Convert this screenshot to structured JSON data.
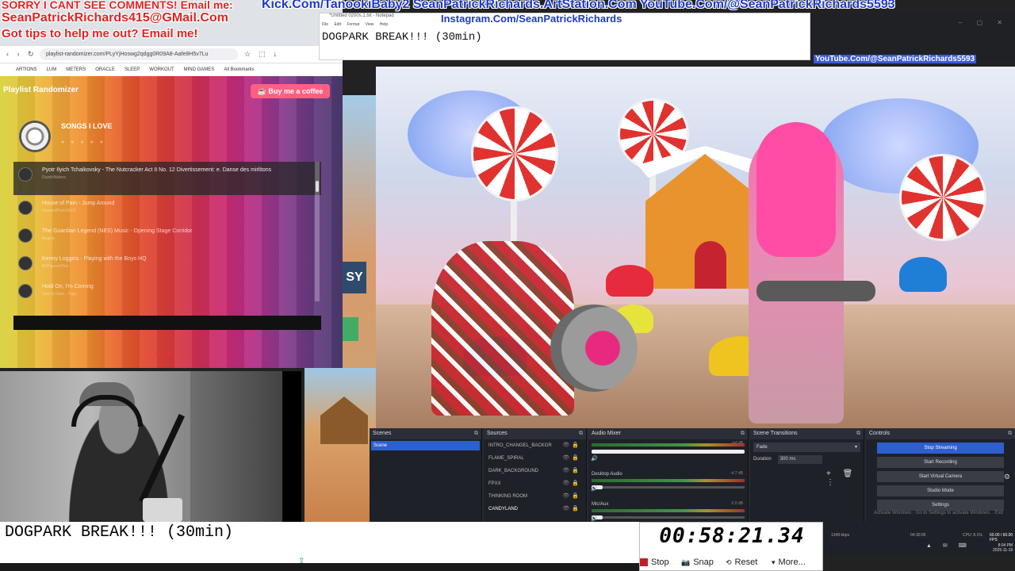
{
  "overlay": {
    "sorry": "SORRY I CANT SEE COMMENTS! Email me:",
    "email": "SeanPatrickRichards415@GMail.Com",
    "tips": "Got tips to help me out? Email me!",
    "links": "Kick.Com/TanookiBaby2 SeanPatrickRichards.ArtStation.Com YouTube.Com/@SeanPatrickRichards5593",
    "instagram": "Instagram.Com/SeanPatrickRichards",
    "youtube_small": "YouTube.Com/@SeanPatrickRichards5593"
  },
  "notepad": {
    "title": "*Untitled 0200s.1.txt - Notepad",
    "menu": "File Edit Format View Help",
    "text": "DOGPARK BREAK!!! (30min)"
  },
  "browser": {
    "url": "playlist-randomizer.com/PLyYjHoswg2qdgg0R09A8-Aafe8H5v7Lu",
    "bookmarks": [
      "ARTIONS",
      "LUM",
      "METERS",
      "ORACLE",
      "SLEEP",
      "WORKOUT",
      "MIND GAMES",
      "All Bookmarks"
    ]
  },
  "playlist": {
    "app_title": "Playlist Randomizer",
    "coffee_label": "Buy me a coffee",
    "coffee_icon": "coffee-cup-icon",
    "name": "SONGS I LOVE",
    "tracks": [
      {
        "title": "Pyotr Ilyich Tchaikovsky - The Nutcracker Act II No. 12 Divertissement: e. Danse des mirlitons",
        "artist": "DumbWalters",
        "active": true
      },
      {
        "title": "House of Pain - Jump Around",
        "artist": "HouseofPainVEVO",
        "active": false
      },
      {
        "title": "The Guardian Legend (NES) Music - Opening Stage Corridor",
        "artist": "Regina",
        "active": false
      },
      {
        "title": "Kenny Loggins - Playing with the Boys HQ",
        "artist": "MrPopcornPop",
        "active": false
      },
      {
        "title": "Hold On, I'm Coming",
        "artist": "Sam & Dave - Topic",
        "active": false
      }
    ]
  },
  "obs": {
    "scenes_title": "Scenes",
    "scenes": [
      "Scene"
    ],
    "sources_title": "Sources",
    "sources": [
      "INTRO_CHANGEL_BACKGR",
      "FLAME_SPIRAL",
      "DARK_BACKGROUND",
      "FPXX",
      "THINKING ROOM",
      "CANDYLAND"
    ],
    "mixer_title": "Audio Mixer",
    "channels": [
      {
        "name": "",
        "db": "-inf dB"
      },
      {
        "name": "Desktop Audio",
        "db": "-4.7 dB"
      },
      {
        "name": "Mic/Aux",
        "db": "0.0 dB"
      }
    ],
    "transitions_title": "Scene Transitions",
    "transition": "Fade",
    "duration_label": "Duration",
    "duration_value": "300 ms",
    "controls_title": "Controls",
    "controls": [
      "Stop Streaming",
      "Start Recording",
      "Start Virtual Camera",
      "Studio Mode",
      "Settings",
      "Exit"
    ],
    "activate": "Activate Windows",
    "activate_sub": "Go to Settings to activate Windows."
  },
  "status": {
    "kbps": "1349 kbps",
    "rec": "04:30:00",
    "cpu": "CPU: 8.1%",
    "fps": "60.00 / 60.00 FPS",
    "time": "8:04 PM",
    "date": "2025-11-19"
  },
  "bottom": {
    "title": "DOGPARK BREAK!!! (30min)"
  },
  "timer": {
    "time": "00:58:21.34",
    "stop": "Stop",
    "snap": "Snap",
    "reset": "Reset",
    "more": "More..."
  },
  "game": {
    "sign_text": "SY"
  }
}
